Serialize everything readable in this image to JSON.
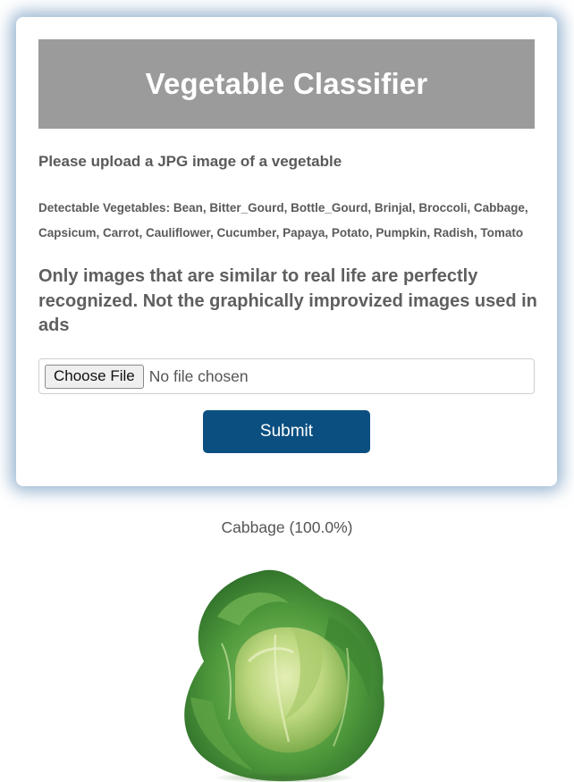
{
  "header": {
    "title": "Vegetable Classifier"
  },
  "form": {
    "upload_prompt": "Please upload a JPG image of a vegetable",
    "detectable_vegetables": "Detectable Vegetables: Bean, Bitter_Gourd, Bottle_Gourd, Brinjal, Broccoli, Cabbage, Capsicum, Carrot, Cauliflower, Cucumber, Papaya, Potato, Pumpkin, Radish, Tomato",
    "disclaimer": "Only images that are similar to real life are perfectly recognized. Not the graphically improvized images used in ads",
    "file_input": {
      "button_label": "Choose File",
      "status": "No file chosen"
    },
    "submit_label": "Submit"
  },
  "result": {
    "prediction": "Cabbage (100.0%)",
    "image_subject": "cabbage-image"
  },
  "colors": {
    "header_bg": "#9b9b9b",
    "submit_bg": "#0b4f80",
    "card_glow": "#4678aa",
    "text": "#5a5a5a"
  }
}
